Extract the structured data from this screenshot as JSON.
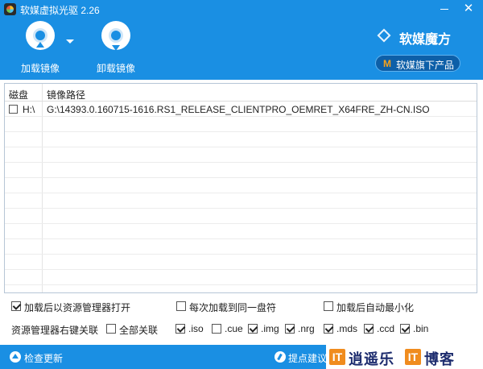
{
  "window": {
    "title": "软媒虚拟光驱 2.26",
    "minimize_label": "",
    "close_label": "✕"
  },
  "toolbar": {
    "mount_label": "加载镜像",
    "unmount_label": "卸载镜像",
    "brand_name": "软媒魔方",
    "flagship_label": "软媒旗下产品",
    "flagship_badge": "M"
  },
  "list": {
    "columns": [
      "磁盘",
      "镜像路径"
    ],
    "rows": [
      {
        "checked": false,
        "drive": "H:\\",
        "path": "G:\\14393.0.160715-1616.RS1_RELEASE_CLIENTPRO_OEMRET_X64FRE_ZH-CN.ISO"
      }
    ]
  },
  "options": {
    "open_explorer_after_mount": {
      "label": "加载后以资源管理器打开",
      "checked": true
    },
    "mount_same_drive": {
      "label": "每次加载到同一盘符",
      "checked": false
    },
    "minimize_after_mount": {
      "label": "加载后自动最小化",
      "checked": false
    },
    "context_menu_label": "资源管理器右键关联",
    "associate_all": {
      "label": "全部关联",
      "checked": false
    },
    "extensions": [
      {
        "label": ".iso",
        "checked": true
      },
      {
        "label": ".cue",
        "checked": false
      },
      {
        "label": ".img",
        "checked": true
      },
      {
        "label": ".nrg",
        "checked": true
      },
      {
        "label": ".mds",
        "checked": true
      },
      {
        "label": ".ccd",
        "checked": true
      },
      {
        "label": ".bin",
        "checked": true
      }
    ]
  },
  "statusbar": {
    "check_update_label": "检查更新",
    "suggest_label": "提点建议",
    "watermark_left_badge": "IT",
    "watermark_text_1": "逍遥乐",
    "watermark_right_badge": "IT",
    "watermark_text_2": "博客"
  },
  "colors": {
    "accent": "#1a8fe3",
    "flagship_button": "#0d5fa8",
    "watermark_orange": "#f08c1e"
  }
}
